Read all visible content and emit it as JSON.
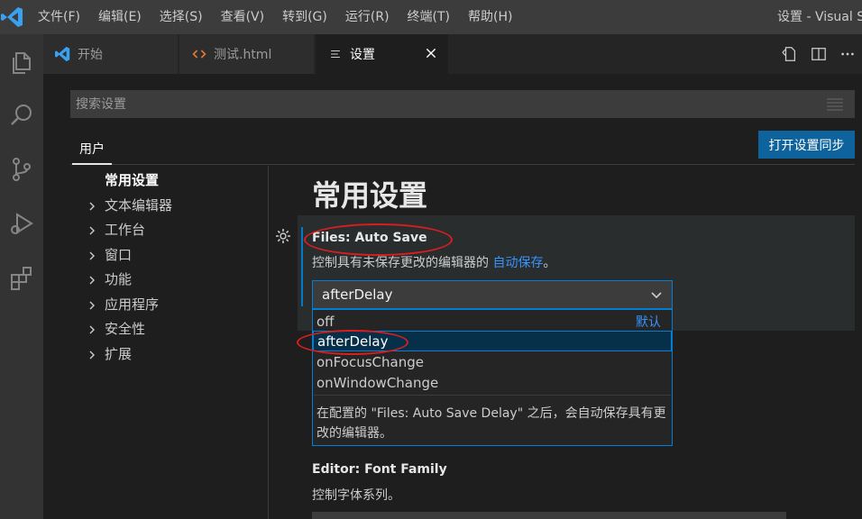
{
  "titlebar": {
    "menus": [
      "文件(F)",
      "编辑(E)",
      "选择(S)",
      "查看(V)",
      "转到(G)",
      "运行(R)",
      "终端(T)",
      "帮助(H)"
    ],
    "window_title": "设置 - Visual S"
  },
  "tabs": [
    {
      "label": "开始",
      "icon": "vscode-icon"
    },
    {
      "label": "测试.html",
      "icon": "html-icon"
    },
    {
      "label": "设置",
      "icon": "settings-file-icon",
      "active": true
    }
  ],
  "search": {
    "placeholder": "搜索设置"
  },
  "scope": {
    "user_tab": "用户",
    "sync_button": "打开设置同步"
  },
  "toc": {
    "items": [
      {
        "label": "常用设置",
        "selected": true
      },
      {
        "label": "文本编辑器"
      },
      {
        "label": "工作台"
      },
      {
        "label": "窗口"
      },
      {
        "label": "功能"
      },
      {
        "label": "应用程序"
      },
      {
        "label": "安全性"
      },
      {
        "label": "扩展"
      }
    ]
  },
  "section_title": "常用设置",
  "auto_save": {
    "category": "Files: ",
    "name": "Auto Save",
    "description_prefix": "控制具有未保存更改的编辑器的 ",
    "description_link": "自动保存",
    "description_suffix": "。",
    "value": "afterDelay",
    "options": [
      {
        "label": "off",
        "default_label": "默认"
      },
      {
        "label": "afterDelay",
        "selected": true
      },
      {
        "label": "onFocusChange"
      },
      {
        "label": "onWindowChange"
      }
    ],
    "option_description": "在配置的 \"Files: Auto Save Delay\" 之后，会自动保存具有更改的编辑器。"
  },
  "font_family": {
    "category": "Editor: ",
    "name": "Font Family",
    "description": "控制字体系列。"
  },
  "colors": {
    "accent": "#007acc",
    "link": "#3794ff",
    "annotation": "#d81e1e"
  }
}
